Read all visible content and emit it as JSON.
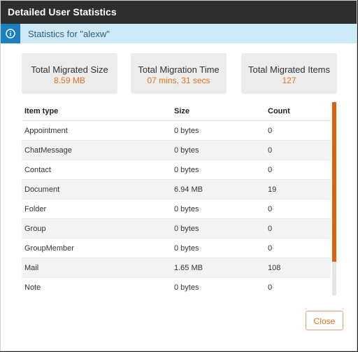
{
  "dialog": {
    "title": "Detailed User Statistics"
  },
  "info": {
    "message": "Statistics for \"alexw\""
  },
  "cards": [
    {
      "label": "Total Migrated Size",
      "value": "8.59 MB"
    },
    {
      "label": "Total Migration Time",
      "value": "07 mins, 31 secs"
    },
    {
      "label": "Total Migrated Items",
      "value": "127"
    }
  ],
  "table": {
    "headers": [
      "Item type",
      "Size",
      "Count"
    ],
    "rows": [
      [
        "Appointment",
        "0 bytes",
        "0"
      ],
      [
        "ChatMessage",
        "0 bytes",
        "0"
      ],
      [
        "Contact",
        "0 bytes",
        "0"
      ],
      [
        "Document",
        "6.94 MB",
        "19"
      ],
      [
        "Folder",
        "0 bytes",
        "0"
      ],
      [
        "Group",
        "0 bytes",
        "0"
      ],
      [
        "GroupMember",
        "0 bytes",
        "0"
      ],
      [
        "Mail",
        "1.65 MB",
        "108"
      ],
      [
        "Note",
        "0 bytes",
        "0"
      ]
    ]
  },
  "footer": {
    "close_label": "Close"
  },
  "colors": {
    "accent": "#e8711c",
    "titlebar": "#2e2e2e",
    "info_bg": "#cfeaf7",
    "info_icon_bg": "#1b7fc4"
  }
}
